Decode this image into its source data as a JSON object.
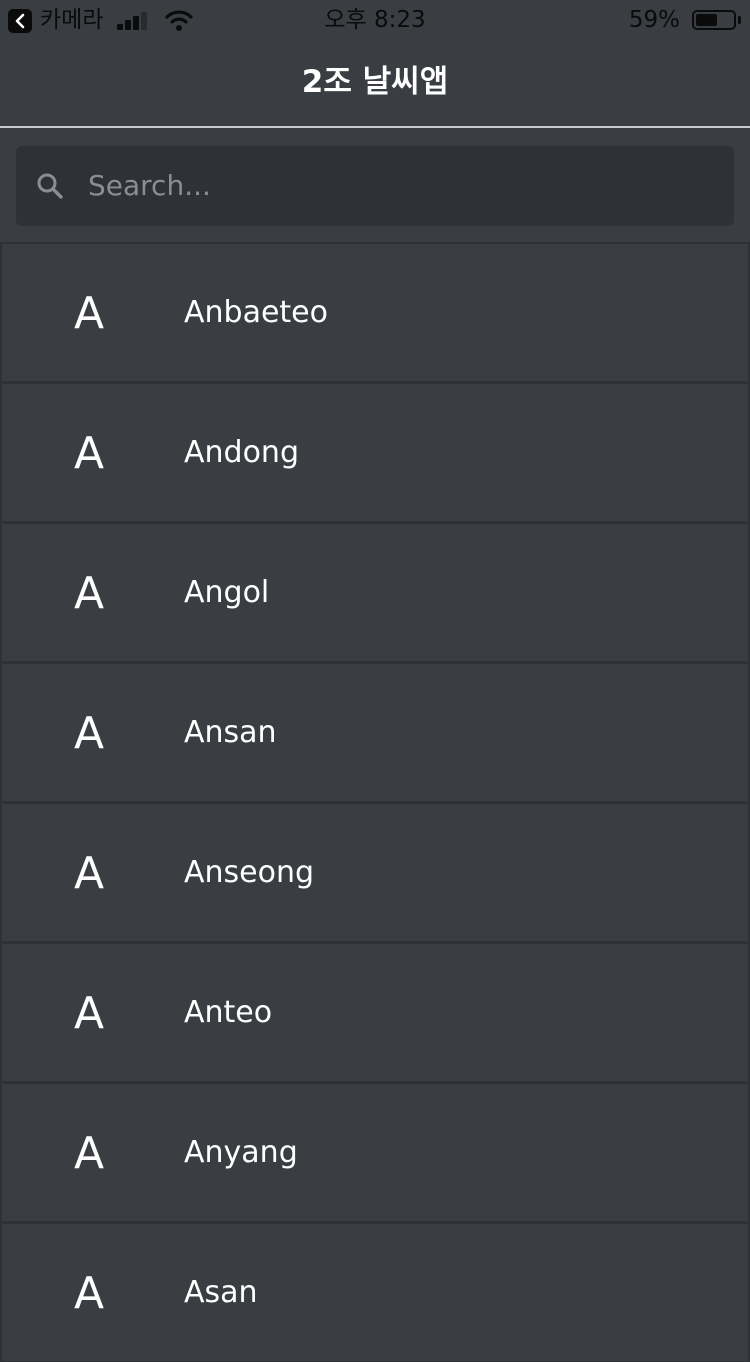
{
  "status_bar": {
    "back_app": "카메라",
    "time": "오후 8:23",
    "battery_percent": "59%",
    "battery_level": 0.59,
    "signal_bars": 3
  },
  "nav": {
    "title": "2조 날씨앱"
  },
  "search": {
    "placeholder": "Search...",
    "icon": "search-icon"
  },
  "cities": [
    {
      "initial": "A",
      "name": "Anbaeteo"
    },
    {
      "initial": "A",
      "name": "Andong"
    },
    {
      "initial": "A",
      "name": "Angol"
    },
    {
      "initial": "A",
      "name": "Ansan"
    },
    {
      "initial": "A",
      "name": "Anseong"
    },
    {
      "initial": "A",
      "name": "Anteo"
    },
    {
      "initial": "A",
      "name": "Anyang"
    },
    {
      "initial": "A",
      "name": "Asan"
    }
  ]
}
